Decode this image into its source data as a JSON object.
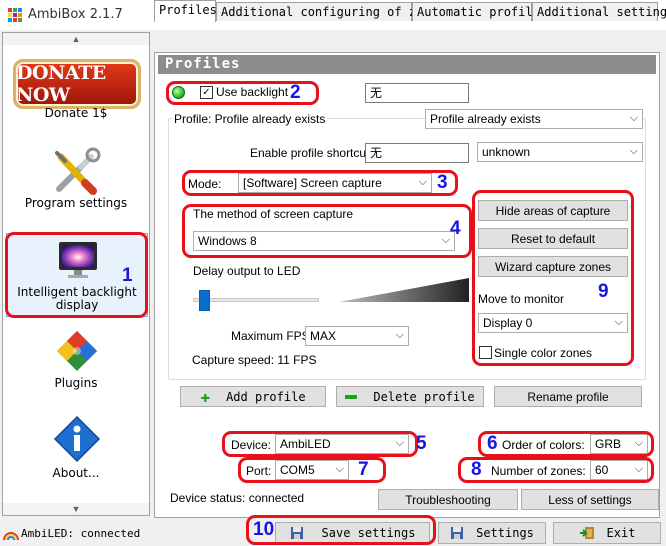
{
  "window": {
    "title": "AmbiBox 2.1.7",
    "minimize": "—",
    "maximize": "☐",
    "close": "✕"
  },
  "sidebar": {
    "items": [
      {
        "label": "Donate 1$",
        "logo_text": "DONATE NOW"
      },
      {
        "label": "Program settings"
      },
      {
        "label_line1": "Intelligent backlight",
        "label_line2": "display"
      },
      {
        "label": "Plugins"
      },
      {
        "label": "About..."
      }
    ]
  },
  "tabs": [
    {
      "label": "Profiles"
    },
    {
      "label": "Additional configuring of zones"
    },
    {
      "label": "Automatic profiles"
    },
    {
      "label": "Additional settings"
    }
  ],
  "profiles": {
    "header": "Profiles",
    "use_backlight_label": "Use backlight",
    "use_backlight_checked": "✓",
    "name_value": "无",
    "profile_label": "Profile: Profile already exists",
    "profile_select": "Profile already exists",
    "shortcut_label": "Enable profile shortcut:",
    "shortcut_value": "无",
    "shortcut_key_select": "unknown",
    "mode_label": "Mode:",
    "mode_select": "[Software] Screen capture",
    "capture_method_label": "The method of screen capture",
    "capture_method_select": "Windows 8",
    "delay_label": "Delay output to LED",
    "delay_level": 0.05,
    "max_fps_label": "Maximum FPS",
    "max_fps_select": "MAX",
    "capture_speed": "Capture speed: 11 FPS",
    "hide_areas_button": "Hide areas of capture",
    "reset_button": "Reset to default",
    "wizard_button": "Wizard capture zones",
    "move_to_monitor_label": "Move to monitor",
    "monitor_select": "Display 0",
    "single_color_label": "Single color zones",
    "add_profile_button": "Add profile",
    "delete_profile_button": "Delete profile",
    "rename_profile_button": "Rename profile",
    "device_label": "Device:",
    "device_select": "AmbiLED",
    "order_label": "Order of colors:",
    "order_select": "GRB",
    "port_label": "Port:",
    "port_select": "COM5",
    "zones_label": "Number of zones:",
    "zones_select": "60",
    "device_status": "Device status: connected",
    "troubleshooting_button": "Troubleshooting",
    "less_settings_button": "Less of settings"
  },
  "annotations": [
    "1",
    "2",
    "3",
    "4",
    "5",
    "6",
    "7",
    "8",
    "9",
    "10"
  ],
  "statusbar": {
    "connection": "AmbiLED: connected",
    "save_button": "Save settings",
    "settings_button": "Settings",
    "exit_button": "Exit"
  },
  "colors": {
    "annotation_red": "#e8101a",
    "annotation_blue": "#1616e0",
    "header_gray": "#8d8d8d",
    "slider_blue": "#0a6ed1",
    "status_green": "#27c32a"
  }
}
